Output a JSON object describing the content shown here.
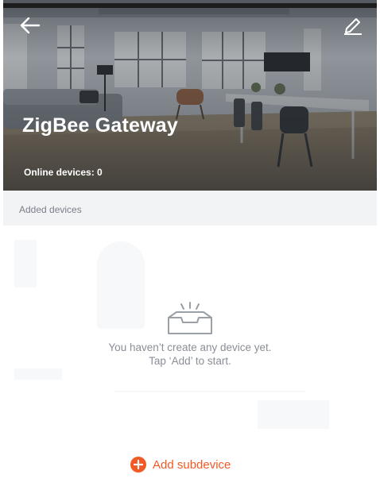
{
  "header": {
    "title": "ZigBee Gateway",
    "online_label": "Online devices: 0",
    "back_icon": "arrow-left-icon",
    "edit_icon": "pencil-icon"
  },
  "section": {
    "label": "Added devices"
  },
  "empty_state": {
    "icon": "empty-tray-icon",
    "line1": "You haven’t create any device yet.",
    "line2": "Tap ‘Add’ to start."
  },
  "actions": {
    "add_subdevice_label": "Add subdevice",
    "add_icon": "plus-circle-icon"
  },
  "colors": {
    "accent": "#f15a24",
    "section_bg": "#f2f3f5",
    "muted_text": "#8a8f96"
  }
}
